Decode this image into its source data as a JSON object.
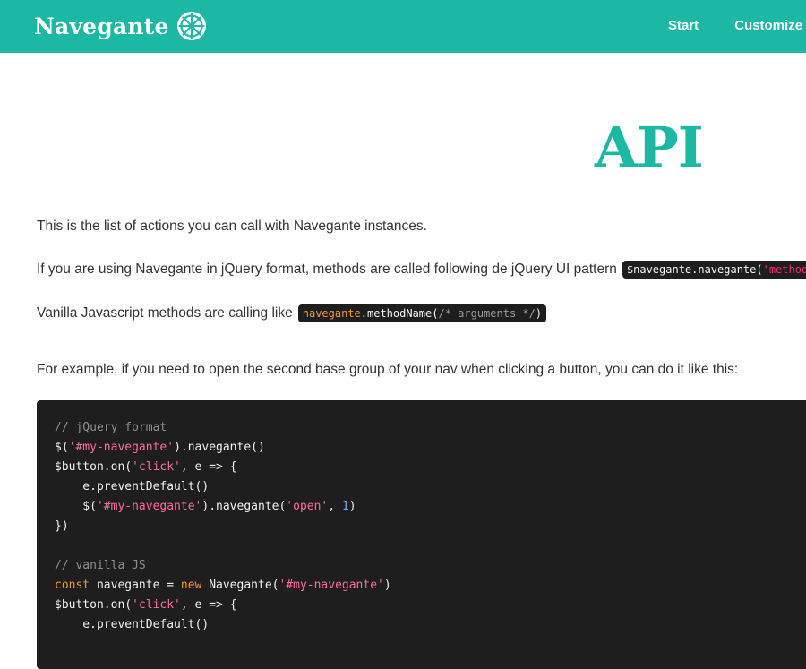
{
  "brand": {
    "name": "Navegante",
    "icon": "ship-wheel-icon"
  },
  "nav": [
    {
      "label": "Start"
    },
    {
      "label": "Customize"
    }
  ],
  "page": {
    "title": "API",
    "intro": "This is the list of actions you can call with Navegante instances.",
    "jquery_text": "If you are using Navegante in jQuery format, methods are called following de jQuery UI pattern",
    "jquery_code": {
      "prefix": "$navegante.navegante(",
      "arg": "'method"
    },
    "vanilla_text": "Vanilla Javascript methods are calling like",
    "vanilla_code": {
      "obj": "navegante",
      "method": ".methodName(",
      "comment": "/* arguments */",
      "close": ")"
    },
    "example_text": "For example, if you need to open the second base group of your nav when clicking a button, you can do it like this:"
  },
  "code_lines": [
    [
      {
        "t": "// jQuery format",
        "c": "com"
      }
    ],
    [
      {
        "t": "$(",
        "c": "txt"
      },
      {
        "t": "'#my-navegante'",
        "c": "str"
      },
      {
        "t": ").navegante()",
        "c": "txt"
      }
    ],
    [
      {
        "t": "$button.on(",
        "c": "txt"
      },
      {
        "t": "'click'",
        "c": "str"
      },
      {
        "t": ", e => {",
        "c": "txt"
      }
    ],
    [
      {
        "t": "    e.preventDefault()",
        "c": "txt"
      }
    ],
    [
      {
        "t": "    $(",
        "c": "txt"
      },
      {
        "t": "'#my-navegante'",
        "c": "str"
      },
      {
        "t": ").navegante(",
        "c": "txt"
      },
      {
        "t": "'open'",
        "c": "str"
      },
      {
        "t": ", ",
        "c": "txt"
      },
      {
        "t": "1",
        "c": "num"
      },
      {
        "t": ")",
        "c": "txt"
      }
    ],
    [
      {
        "t": "})",
        "c": "txt"
      }
    ],
    [
      {
        "t": "",
        "c": "txt"
      }
    ],
    [
      {
        "t": "// vanilla JS",
        "c": "com"
      }
    ],
    [
      {
        "t": "const",
        "c": "kw"
      },
      {
        "t": " navegante = ",
        "c": "txt"
      },
      {
        "t": "new",
        "c": "kw"
      },
      {
        "t": " Navegante(",
        "c": "txt"
      },
      {
        "t": "'#my-navegante'",
        "c": "str"
      },
      {
        "t": ")",
        "c": "txt"
      }
    ],
    [
      {
        "t": "$button.on(",
        "c": "txt"
      },
      {
        "t": "'click'",
        "c": "str"
      },
      {
        "t": ", e => {",
        "c": "txt"
      }
    ],
    [
      {
        "t": "    e.preventDefault()",
        "c": "txt"
      }
    ]
  ],
  "colors": {
    "accent": "#1bb8a3",
    "code_bg": "#1e1e1e"
  }
}
